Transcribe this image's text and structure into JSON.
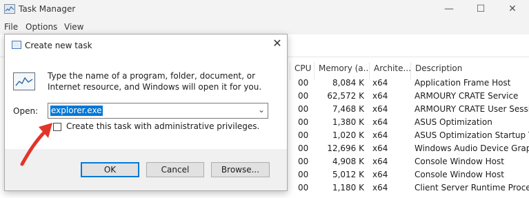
{
  "task_manager": {
    "title": "Task Manager",
    "menu": [
      "File",
      "Options",
      "View"
    ],
    "columns": [
      "CPU",
      "Memory (a...",
      "Archite...",
      "Description"
    ],
    "rows": [
      {
        "cpu": "00",
        "memory": "8,084 K",
        "arch": "x64",
        "description": "Application Frame Host"
      },
      {
        "cpu": "00",
        "memory": "62,572 K",
        "arch": "x64",
        "description": "ARMOURY CRATE Service"
      },
      {
        "cpu": "00",
        "memory": "7,468 K",
        "arch": "x64",
        "description": "ARMOURY CRATE User Sessi"
      },
      {
        "cpu": "00",
        "memory": "1,380 K",
        "arch": "x64",
        "description": "ASUS Optimization"
      },
      {
        "cpu": "00",
        "memory": "1,020 K",
        "arch": "x64",
        "description": "ASUS Optimization Startup T"
      },
      {
        "cpu": "00",
        "memory": "12,696 K",
        "arch": "x64",
        "description": "Windows Audio Device Grap"
      },
      {
        "cpu": "00",
        "memory": "4,908 K",
        "arch": "x64",
        "description": "Console Window Host"
      },
      {
        "cpu": "00",
        "memory": "5,012 K",
        "arch": "x64",
        "description": "Console Window Host"
      },
      {
        "cpu": "00",
        "memory": "1,180 K",
        "arch": "x64",
        "description": "Client Server Runtime Proces"
      }
    ]
  },
  "dialog": {
    "title": "Create new task",
    "description": "Type the name of a program, folder, document, or Internet resource, and Windows will open it for you.",
    "open_label": "Open:",
    "open_value": "explorer.exe",
    "admin_label": "Create this task with administrative privileges.",
    "ok_label": "OK",
    "cancel_label": "Cancel",
    "browse_label": "Browse..."
  },
  "colors": {
    "selection": "#0078d7",
    "arrow": "#e0352b"
  }
}
